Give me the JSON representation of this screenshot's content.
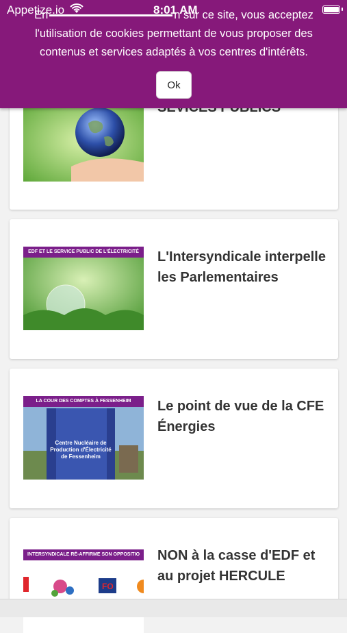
{
  "status_bar": {
    "carrier": "Appetize.io",
    "time": "8:01 AM"
  },
  "cookie_banner": {
    "line1_start": "En",
    "line1_end": "n sur ce site, vous acceptez",
    "line2": "l'utilisation de cookies permettant de vous proposer des",
    "line3": "contenus et services adaptés à vos centres d'intérêts.",
    "ok_label": "Ok"
  },
  "articles": [
    {
      "title": "SEVICES PUBLICS",
      "band": "",
      "thumb_icon": "globe-in-hand-icon"
    },
    {
      "title": "L'Intersyndicale interpelle les Parlementaires",
      "band": "EDF ET LE SERVICE PUBLIC DE L'ÉLECTRICITÉ",
      "thumb_icon": "glass-globe-icon"
    },
    {
      "title": "Le point de vue de la CFE Énergies",
      "band": "LA COUR DES COMPTES À FESSENHEIM",
      "thumb_text": "Centre Nucléaire de Production d'Électricité de Fessenheim",
      "thumb_icon": "nuclear-plant-sign-icon"
    },
    {
      "title": "NON à la casse d'EDF et au projet HERCULE",
      "band": "INTERSYNDICALE RÉ-AFFIRME SON OPPOSITIO",
      "thumb_icon": "union-logos-icon"
    }
  ]
}
